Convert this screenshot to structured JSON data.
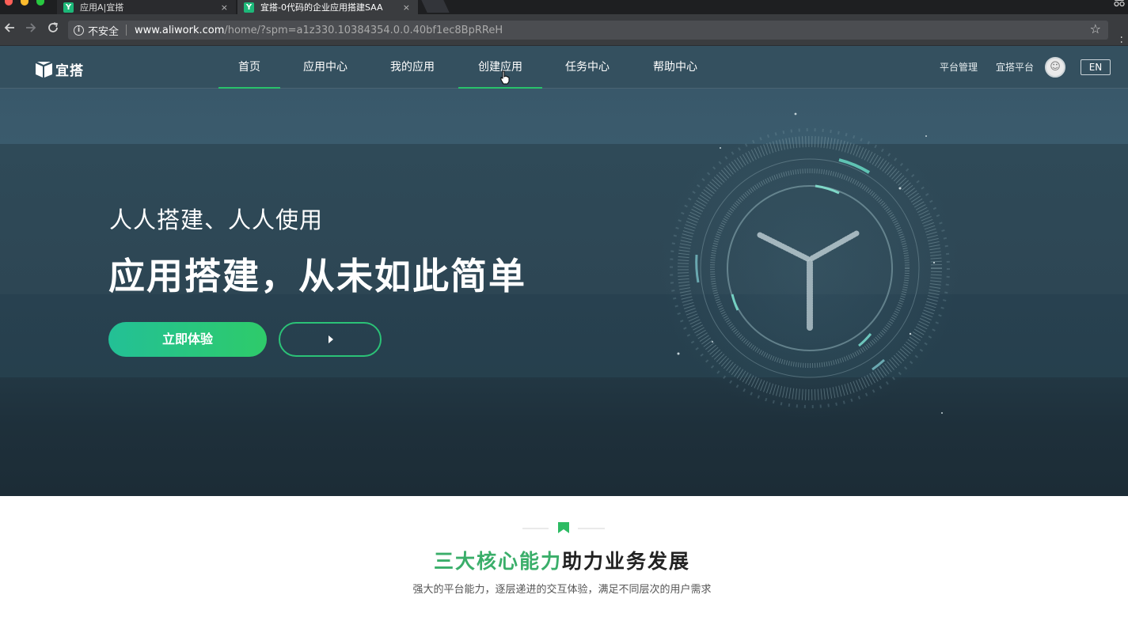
{
  "browser": {
    "tabs": [
      {
        "title": "应用A|宜搭",
        "state": "inactive"
      },
      {
        "title": "宜搭-0代码的企业应用搭建SAA",
        "state": "active"
      }
    ],
    "security_label": "不安全",
    "url_host": "www.aliwork.com",
    "url_path": "/home/?spm=a1z330.10384354.0.0.40bf1ec8BpRReH",
    "close_glyph": "×",
    "icons": [
      "back-arrow",
      "forward-arrow",
      "reload",
      "info",
      "star",
      "kebab-menu",
      "incognito"
    ]
  },
  "header": {
    "logo_text": "宜搭",
    "nav": [
      {
        "label": "首页",
        "state": "active"
      },
      {
        "label": "应用中心",
        "state": "normal"
      },
      {
        "label": "我的应用",
        "state": "normal"
      },
      {
        "label": "创建应用",
        "state": "hover"
      },
      {
        "label": "任务中心",
        "state": "normal"
      },
      {
        "label": "帮助中心",
        "state": "normal"
      }
    ],
    "platform_manage": "平台管理",
    "platform_name": "宜搭平台",
    "lang_button": "EN"
  },
  "hero": {
    "subtitle": "人人搭建、人人使用",
    "title": "应用搭建，从未如此简单",
    "primary_button": "立即体验",
    "play_button_icon": "play-icon"
  },
  "section": {
    "title_highlight": "三大核心能力",
    "title_rest": "助力业务发展",
    "description": "强大的平台能力，逐层递进的交互体验，满足不同层次的用户需求"
  },
  "colors": {
    "header_bg": "#34505f",
    "accent_green": "#29c26b",
    "highlight_green": "#3aae6a"
  }
}
